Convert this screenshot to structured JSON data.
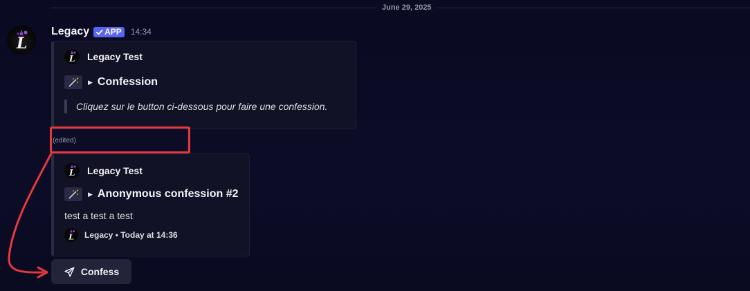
{
  "date_divider": "June 29, 2025",
  "message": {
    "username": "Legacy",
    "badge": "APP",
    "time": "14:34",
    "edited_label": "(edited)"
  },
  "embeds": [
    {
      "author": "Legacy Test",
      "title": "Confession",
      "quote": "Cliquez sur le button ci-dessous pour faire une confession."
    },
    {
      "author": "Legacy Test",
      "title": "Anonymous confession #2",
      "description": "test a test a test",
      "footer": "Legacy • Today at 14:36"
    }
  ],
  "button": {
    "label": "Confess",
    "icon": "paper-plane-icon"
  },
  "colors": {
    "accent": "#5865f2",
    "annotation": "#e5393c",
    "background": "#0b0b24"
  }
}
